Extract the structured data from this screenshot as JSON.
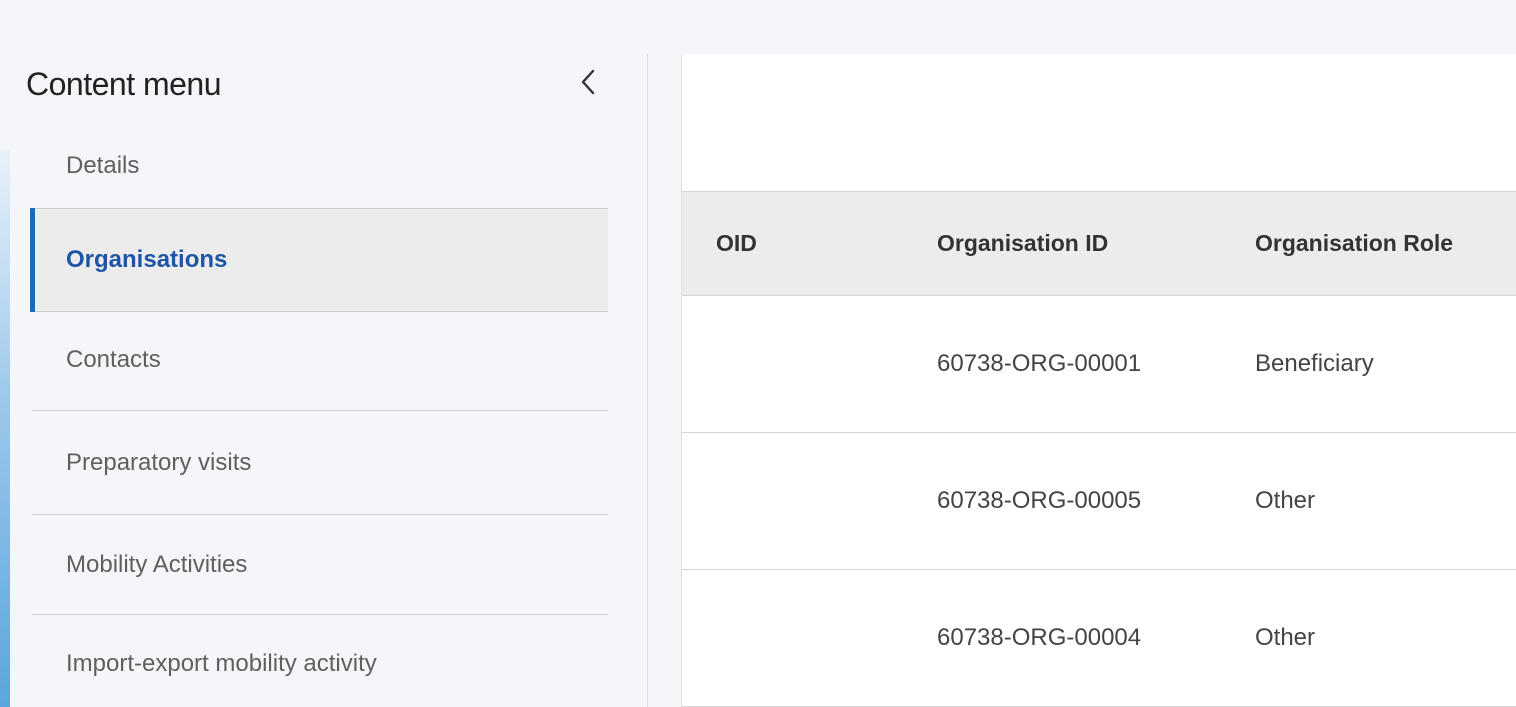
{
  "sidebar": {
    "title": "Content menu",
    "collapse_icon": "chevron-left-icon",
    "items": [
      {
        "label": "Details",
        "active": false
      },
      {
        "label": "Organisations",
        "active": true
      },
      {
        "label": "Contacts",
        "active": false
      },
      {
        "label": "Preparatory visits",
        "active": false
      },
      {
        "label": "Mobility Activities",
        "active": false
      },
      {
        "label": "Import-export mobility activity",
        "active": false
      }
    ]
  },
  "table": {
    "columns": [
      "OID",
      "Organisation ID",
      "Organisation Role"
    ],
    "rows": [
      {
        "oid": "",
        "org_id": "60738-ORG-00001",
        "role": "Beneficiary"
      },
      {
        "oid": "",
        "org_id": "60738-ORG-00005",
        "role": "Other"
      },
      {
        "oid": "",
        "org_id": "60738-ORG-00004",
        "role": "Other"
      }
    ]
  },
  "colors": {
    "accent": "#1f55a6",
    "active_bar": "#1f6bb3",
    "header_bg": "#ececec",
    "page_bg": "#f5f6fa"
  }
}
